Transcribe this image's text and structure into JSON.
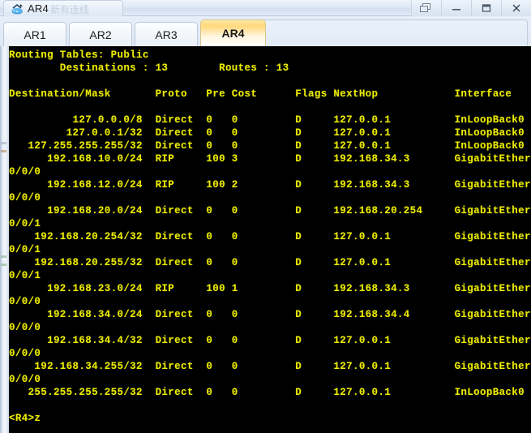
{
  "window": {
    "title": "AR4",
    "ghost_text": "新有连线",
    "icon": "router-icon",
    "buttons": [
      {
        "name": "restore-button",
        "label": "Restore"
      },
      {
        "name": "minimize-button",
        "label": "Minimize"
      },
      {
        "name": "maximize-button",
        "label": "Maximize"
      },
      {
        "name": "close-button",
        "label": "Close"
      }
    ]
  },
  "tabs": [
    {
      "label": "AR1",
      "active": false
    },
    {
      "label": "AR2",
      "active": false
    },
    {
      "label": "AR3",
      "active": false
    },
    {
      "label": "AR4",
      "active": true
    }
  ],
  "console": {
    "text_color": "#ecec00",
    "background_color": "#000000",
    "heading": "Routing Tables: Public",
    "summary": {
      "destinations_label": "Destinations",
      "destinations_value": "13",
      "routes_label": "Routes",
      "routes_value": "13"
    },
    "columns": [
      "Destination/Mask",
      "Proto",
      "Pre",
      "Cost",
      "Flags",
      "NextHop",
      "Interface"
    ],
    "routes": [
      {
        "destination": "127.0.0.0/8",
        "proto": "Direct",
        "pre": "0",
        "cost": "0",
        "flags": "D",
        "nexthop": "127.0.0.1",
        "interface": "InLoopBack0",
        "wrapped": ""
      },
      {
        "destination": "127.0.0.1/32",
        "proto": "Direct",
        "pre": "0",
        "cost": "0",
        "flags": "D",
        "nexthop": "127.0.0.1",
        "interface": "InLoopBack0",
        "wrapped": ""
      },
      {
        "destination": "127.255.255.255/32",
        "proto": "Direct",
        "pre": "0",
        "cost": "0",
        "flags": "D",
        "nexthop": "127.0.0.1",
        "interface": "InLoopBack0",
        "wrapped": ""
      },
      {
        "destination": "192.168.10.0/24",
        "proto": "RIP",
        "pre": "100",
        "cost": "3",
        "flags": "D",
        "nexthop": "192.168.34.3",
        "interface": "GigabitEthernet",
        "wrapped": "0/0/0"
      },
      {
        "destination": "192.168.12.0/24",
        "proto": "RIP",
        "pre": "100",
        "cost": "2",
        "flags": "D",
        "nexthop": "192.168.34.3",
        "interface": "GigabitEthernet",
        "wrapped": "0/0/0"
      },
      {
        "destination": "192.168.20.0/24",
        "proto": "Direct",
        "pre": "0",
        "cost": "0",
        "flags": "D",
        "nexthop": "192.168.20.254",
        "interface": "GigabitEthernet",
        "wrapped": "0/0/1"
      },
      {
        "destination": "192.168.20.254/32",
        "proto": "Direct",
        "pre": "0",
        "cost": "0",
        "flags": "D",
        "nexthop": "127.0.0.1",
        "interface": "GigabitEthernet",
        "wrapped": "0/0/1"
      },
      {
        "destination": "192.168.20.255/32",
        "proto": "Direct",
        "pre": "0",
        "cost": "0",
        "flags": "D",
        "nexthop": "127.0.0.1",
        "interface": "GigabitEthernet",
        "wrapped": "0/0/1"
      },
      {
        "destination": "192.168.23.0/24",
        "proto": "RIP",
        "pre": "100",
        "cost": "1",
        "flags": "D",
        "nexthop": "192.168.34.3",
        "interface": "GigabitEthernet",
        "wrapped": "0/0/0"
      },
      {
        "destination": "192.168.34.0/24",
        "proto": "Direct",
        "pre": "0",
        "cost": "0",
        "flags": "D",
        "nexthop": "192.168.34.4",
        "interface": "GigabitEthernet",
        "wrapped": "0/0/0"
      },
      {
        "destination": "192.168.34.4/32",
        "proto": "Direct",
        "pre": "0",
        "cost": "0",
        "flags": "D",
        "nexthop": "127.0.0.1",
        "interface": "GigabitEthernet",
        "wrapped": "0/0/0"
      },
      {
        "destination": "192.168.34.255/32",
        "proto": "Direct",
        "pre": "0",
        "cost": "0",
        "flags": "D",
        "nexthop": "127.0.0.1",
        "interface": "GigabitEthernet",
        "wrapped": "0/0/0"
      },
      {
        "destination": "255.255.255.255/32",
        "proto": "Direct",
        "pre": "0",
        "cost": "0",
        "flags": "D",
        "nexthop": "127.0.0.1",
        "interface": "InLoopBack0",
        "wrapped": ""
      }
    ],
    "prompt": "<R4>z"
  }
}
